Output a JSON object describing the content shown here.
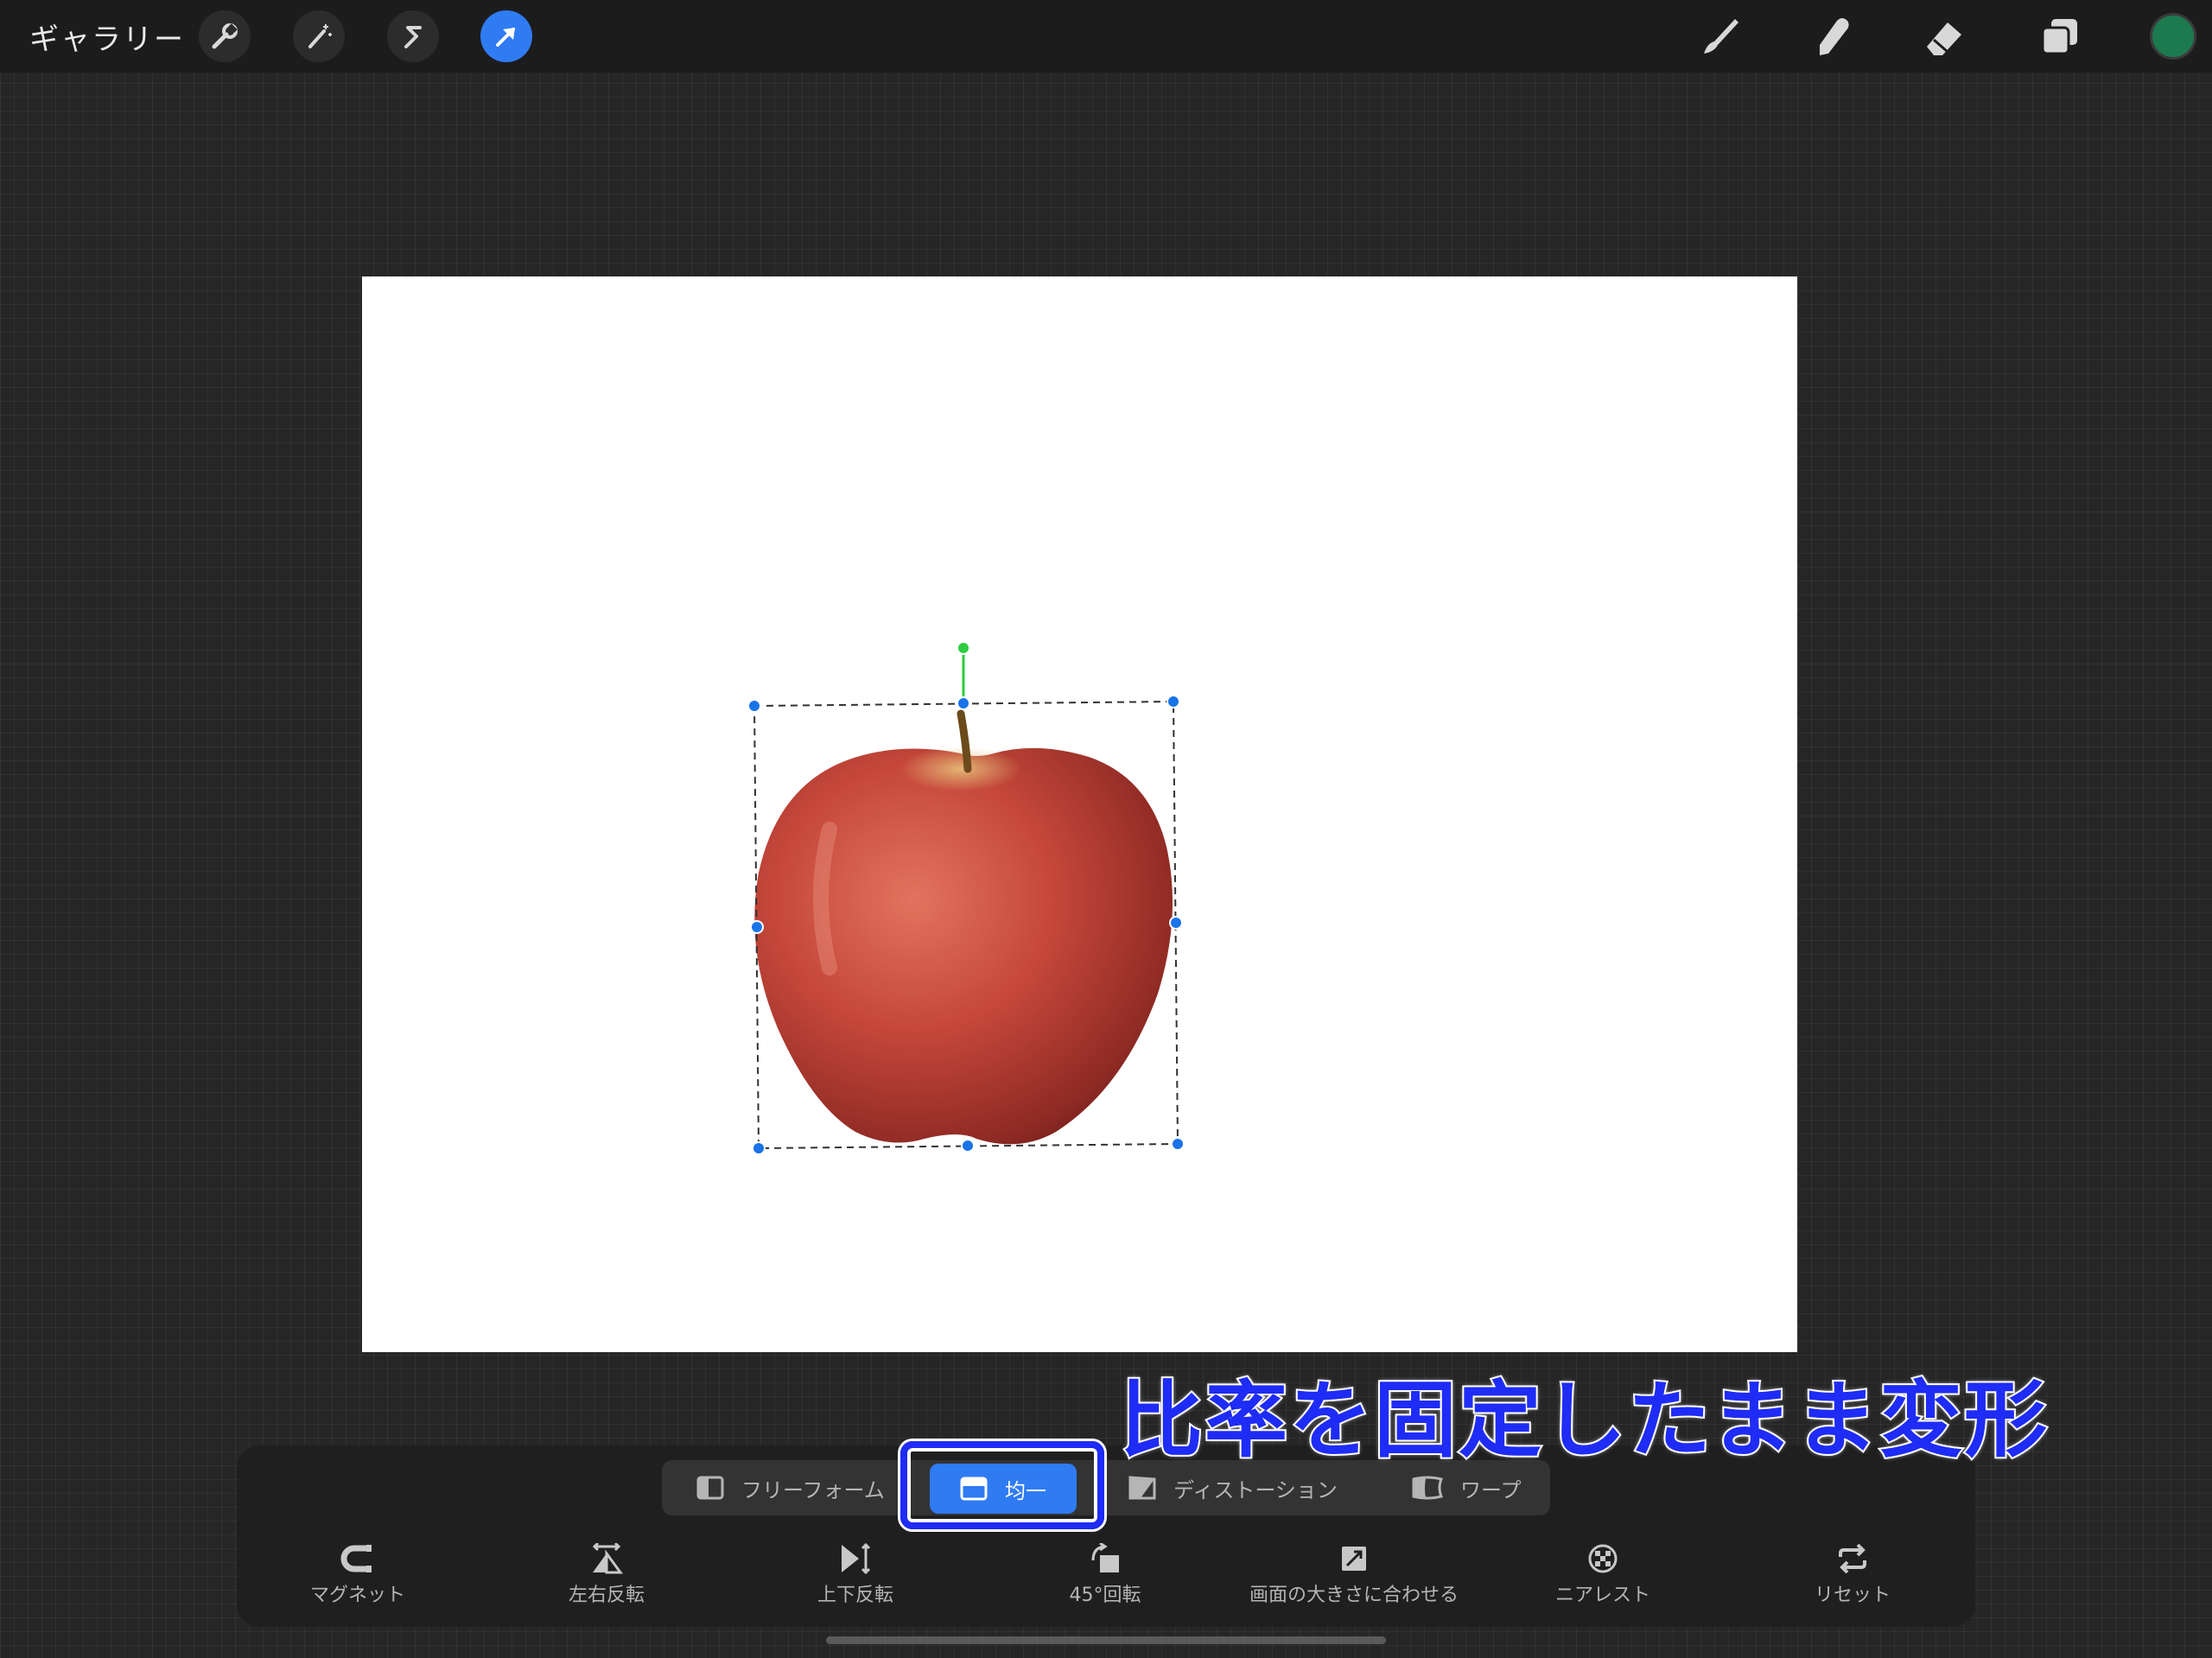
{
  "topbar": {
    "gallery_label": "ギャラリー",
    "left_icons": [
      "wrench-icon",
      "magic-wand-icon",
      "selection-s-icon",
      "transform-arrow-icon"
    ],
    "active_tool": "transform",
    "right_icons": [
      "brush-icon",
      "smudge-icon",
      "eraser-icon",
      "layers-icon"
    ],
    "current_color": "#1d7a4f"
  },
  "caption": "比率を固定したまま変形",
  "transform_modes": [
    {
      "label": "フリーフォーム",
      "icon": "freeform-icon",
      "active": false
    },
    {
      "label": "均一",
      "icon": "uniform-icon",
      "active": true
    },
    {
      "label": "ディストーション",
      "icon": "distort-icon",
      "active": false
    },
    {
      "label": "ワープ",
      "icon": "warp-icon",
      "active": false
    }
  ],
  "tools": [
    {
      "label": "マグネット",
      "icon": "magnet-icon"
    },
    {
      "label": "左右反転",
      "icon": "flip-horizontal-icon"
    },
    {
      "label": "上下反転",
      "icon": "flip-vertical-icon"
    },
    {
      "label": "45°回転",
      "icon": "rotate-45-icon"
    },
    {
      "label": "画面の大きさに合わせる",
      "icon": "fit-to-screen-icon"
    },
    {
      "label": "ニアレスト",
      "icon": "nearest-icon"
    },
    {
      "label": "リセット",
      "icon": "reset-icon"
    }
  ],
  "colors": {
    "accent": "#2f7bf2",
    "caption": "#1f2cf5",
    "handle": "#1a73e8",
    "rotation_handle": "#2ecc40"
  }
}
